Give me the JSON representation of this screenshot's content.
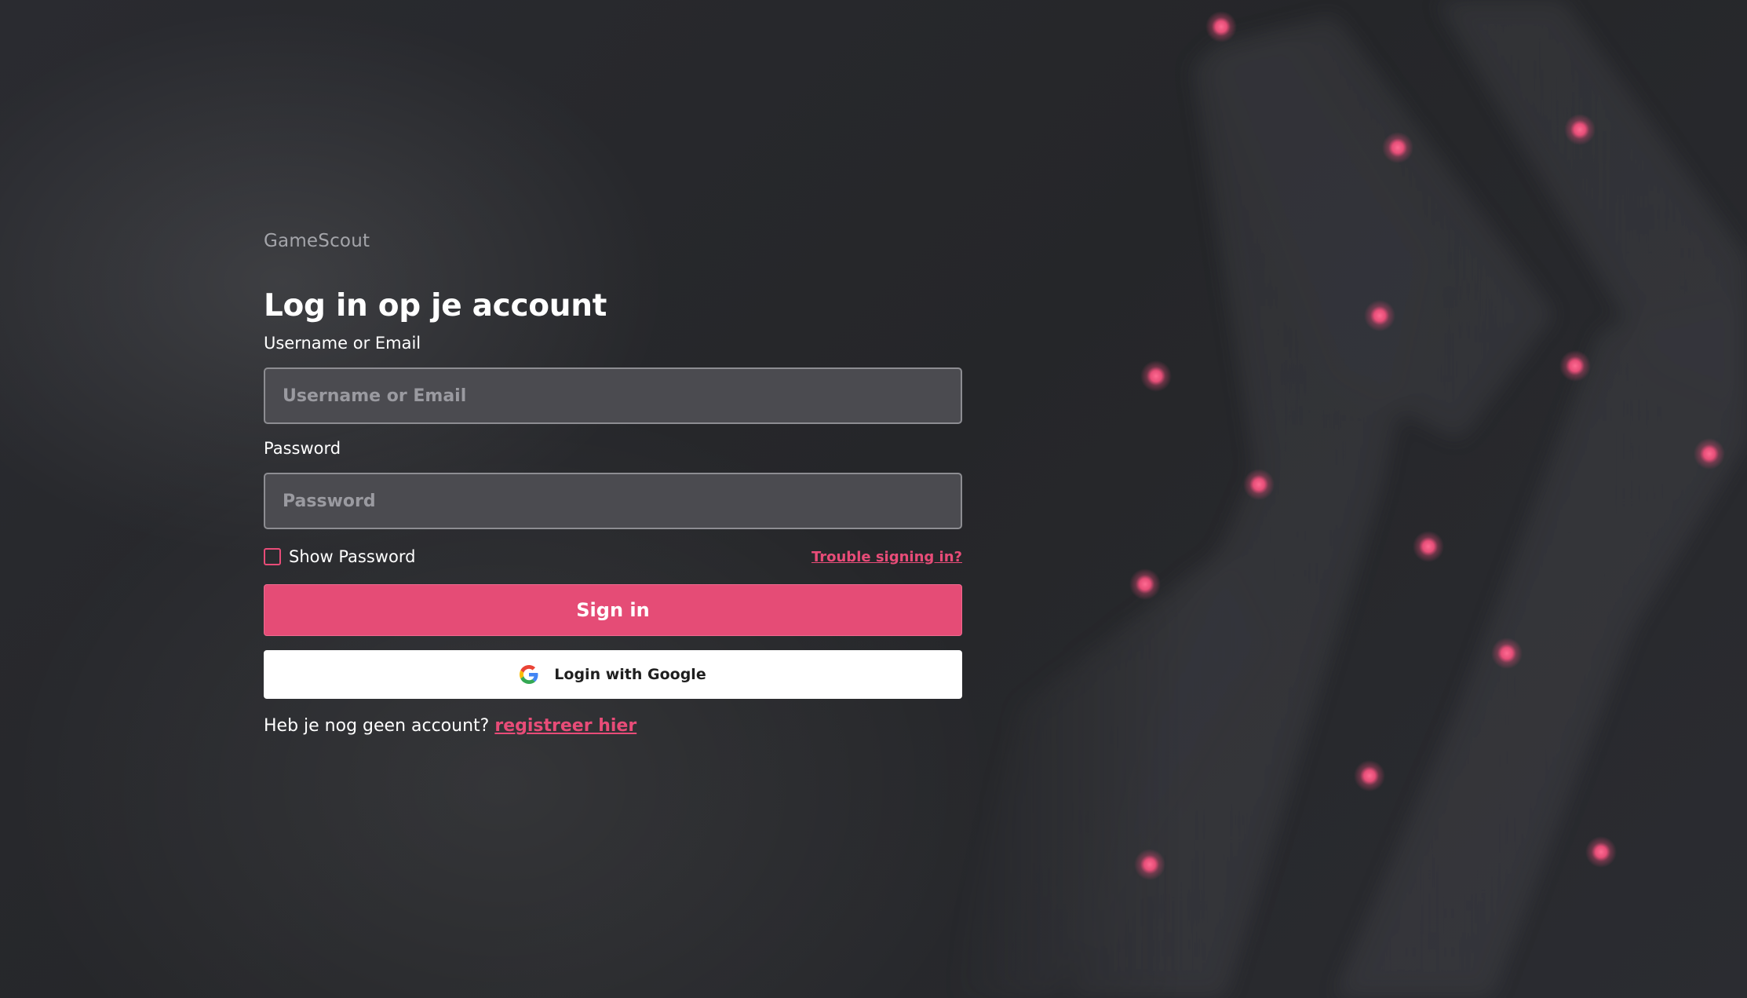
{
  "brand": {
    "name": "GameScout"
  },
  "login": {
    "title": "Log in op je account",
    "username_label": "Username or Email",
    "username_placeholder": "Username or Email",
    "username_value": "",
    "password_label": "Password",
    "password_placeholder": "Password",
    "password_value": "",
    "show_password_label": "Show Password",
    "show_password_checked": false,
    "trouble_link": "Trouble signing in?",
    "signin_button": "Sign in",
    "google_button": "Login with Google",
    "google_icon": "google-g-logo",
    "register_prompt": "Heb je nog geen account?",
    "register_link": "registreer hier"
  },
  "colors": {
    "background": "#26272b",
    "accent": "#e54c76",
    "input_bg": "#4b4b50",
    "input_border": "#8d8d92",
    "glow_dot": "#f0507c",
    "stripe": "#4a4a50"
  }
}
